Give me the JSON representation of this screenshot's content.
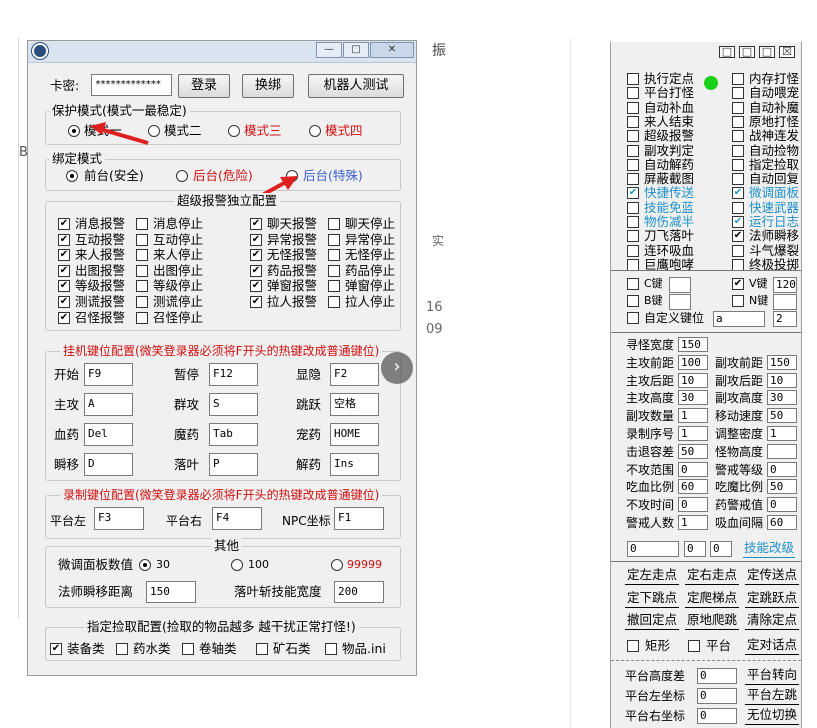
{
  "main": {
    "card_label": "卡密:",
    "card_value": "*************",
    "login_btn": "登录",
    "change_bind_btn": "换绑",
    "robot_test_btn": "机器人测试",
    "protect_group": "保护模式(模式一最稳定)",
    "protect_modes": [
      "模式一",
      "模式二",
      "模式三",
      "模式四"
    ],
    "bind_group": "绑定模式",
    "bind_modes": [
      "前台(安全)",
      "后台(危险)",
      "后台(特殊)"
    ],
    "alarm_group": "超级报警独立配置",
    "alarm_rows": [
      [
        [
          "消息报警",
          true
        ],
        [
          "消息停止",
          false
        ],
        [
          "聊天报警",
          true
        ],
        [
          "聊天停止",
          false
        ]
      ],
      [
        [
          "互动报警",
          true
        ],
        [
          "互动停止",
          false
        ],
        [
          "异常报警",
          true
        ],
        [
          "异常停止",
          false
        ]
      ],
      [
        [
          "来人报警",
          true
        ],
        [
          "来人停止",
          false
        ],
        [
          "无怪报警",
          true
        ],
        [
          "无怪停止",
          false
        ]
      ],
      [
        [
          "出图报警",
          true
        ],
        [
          "出图停止",
          false
        ],
        [
          "药品报警",
          true
        ],
        [
          "药品停止",
          false
        ]
      ],
      [
        [
          "等级报警",
          true
        ],
        [
          "等级停止",
          false
        ],
        [
          "弹窗报警",
          true
        ],
        [
          "弹窗停止",
          false
        ]
      ],
      [
        [
          "测谎报警",
          true
        ],
        [
          "测谎停止",
          false
        ],
        [
          "拉人报警",
          true
        ],
        [
          "拉人停止",
          false
        ]
      ],
      [
        [
          "召怪报警",
          true
        ],
        [
          "召怪停止",
          false
        ]
      ]
    ],
    "hotkey_group": "挂机键位配置(微笑登录器必须将F开头的热键改成普通键位)",
    "hotkeys": [
      [
        [
          "开始",
          "F9"
        ],
        [
          "暂停",
          "F12"
        ],
        [
          "显隐",
          "F2"
        ]
      ],
      [
        [
          "主攻",
          "A"
        ],
        [
          "群攻",
          "S"
        ],
        [
          "跳跃",
          "空格"
        ]
      ],
      [
        [
          "血药",
          "Del"
        ],
        [
          "魔药",
          "Tab"
        ],
        [
          "宠药",
          "HOME"
        ]
      ],
      [
        [
          "瞬移",
          "D"
        ],
        [
          "落叶",
          "P"
        ],
        [
          "解药",
          "Ins"
        ]
      ]
    ],
    "record_group": "录制键位配置(微笑登录器必须将F开头的热键改成普通键位)",
    "record_keys": [
      [
        "平台左",
        "F3"
      ],
      [
        "平台右",
        "F4"
      ],
      [
        "NPC坐标",
        "F1"
      ]
    ],
    "other_group": "其他",
    "fine_tune_label": "微调面板数值",
    "fine_tune_opts": [
      "30",
      "100",
      "99999"
    ],
    "mage_label": "法师瞬移距离",
    "mage_value": "150",
    "leaf_label": "落叶斩技能宽度",
    "leaf_value": "200",
    "pickup_group": "指定捡取配置(捡取的物品越多  越干扰正常打怪!)",
    "pickup_items": [
      [
        "装备类",
        true
      ],
      [
        "药水类",
        false
      ],
      [
        "卷轴类",
        false
      ],
      [
        "矿石类",
        false
      ],
      [
        "物品.ini",
        false
      ]
    ]
  },
  "panel": {
    "title_buttons": [
      "□",
      "□",
      "□",
      "☒"
    ],
    "left_checks": [
      [
        "执行定点",
        false,
        "n"
      ],
      [
        "平台打怪",
        false,
        "n"
      ],
      [
        "自动补血",
        false,
        "n"
      ],
      [
        "来人结束",
        false,
        "n"
      ],
      [
        "超级报警",
        false,
        "n"
      ],
      [
        "副攻判定",
        false,
        "n"
      ],
      [
        "自动解药",
        false,
        "n"
      ],
      [
        "屏蔽截图",
        false,
        "n"
      ],
      [
        "快捷传送",
        true,
        "t"
      ],
      [
        "技能免蓝",
        false,
        "t"
      ],
      [
        "物伤减半",
        false,
        "t"
      ],
      [
        "刀飞落叶",
        false,
        "n"
      ],
      [
        "连环吸血",
        false,
        "n"
      ],
      [
        "巨鹰咆哮",
        false,
        "n"
      ]
    ],
    "right_checks": [
      [
        "内存打怪",
        false,
        "n"
      ],
      [
        "自动喂宠",
        false,
        "n"
      ],
      [
        "自动补魔",
        false,
        "n"
      ],
      [
        "原地打怪",
        false,
        "n"
      ],
      [
        "战神连发",
        false,
        "n"
      ],
      [
        "自动捡物",
        false,
        "n"
      ],
      [
        "指定捡取",
        false,
        "n"
      ],
      [
        "自动回复",
        false,
        "n"
      ],
      [
        "微调面板",
        true,
        "t"
      ],
      [
        "快速武器",
        false,
        "t"
      ],
      [
        "运行日志",
        true,
        "t"
      ],
      [
        "法师瞬移",
        true,
        "n"
      ],
      [
        "斗气爆裂",
        false,
        "n"
      ],
      [
        "终极投掷",
        false,
        "n"
      ]
    ],
    "keys": {
      "c_label": "C键",
      "v_label": "V键",
      "v_value": "120",
      "b_label": "B键",
      "n_label": "N键",
      "custom_label": "自定义键位",
      "custom_key": "a",
      "custom_val": "2"
    },
    "params": [
      [
        "寻怪宽度",
        "150",
        null,
        null
      ],
      [
        "主攻前距",
        "100",
        "副攻前距",
        "150"
      ],
      [
        "主攻后距",
        "10",
        "副攻后距",
        "10"
      ],
      [
        "主攻高度",
        "30",
        "副攻高度",
        "30"
      ],
      [
        "副攻数量",
        "1",
        "移动速度",
        "50"
      ],
      [
        "录制序号",
        "1",
        "调整密度",
        "1"
      ],
      [
        "击退容差",
        "50",
        "怪物高度",
        ""
      ],
      [
        "不攻范围",
        "0",
        "警戒等级",
        "0"
      ],
      [
        "吃血比例",
        "60",
        "吃魔比例",
        "50"
      ],
      [
        "不攻时间",
        "0",
        "药警戒值",
        "0"
      ],
      [
        "警戒人数",
        "1",
        "吸血间隔",
        "60"
      ]
    ],
    "misc_inputs": [
      "0",
      "0",
      "0"
    ],
    "skill_tune_btn": "技能改级",
    "nav_buttons": [
      [
        "定左走点",
        "定右走点",
        "定传送点"
      ],
      [
        "定下跳点",
        "定爬梯点",
        "定跳跃点"
      ],
      [
        "撤回定点",
        "原地爬跳",
        "清除定点"
      ]
    ],
    "rect_label": "矩形",
    "platform_label": "平台",
    "dialog_btn": "定对话点",
    "plat_height_label": "平台高度差",
    "plat_height_val": "0",
    "plat_turn_btn": "平台转向",
    "plat_left_label": "平台左坐标",
    "plat_left_val": "0",
    "plat_left_btn": "平台左跳",
    "plat_right_label": "平台右坐标",
    "plat_right_val": "0",
    "plat_right_btn": "无位切换"
  },
  "bg": {
    "right_chars": [
      "振",
      "实",
      "16",
      "09"
    ],
    "left_char": "B"
  }
}
